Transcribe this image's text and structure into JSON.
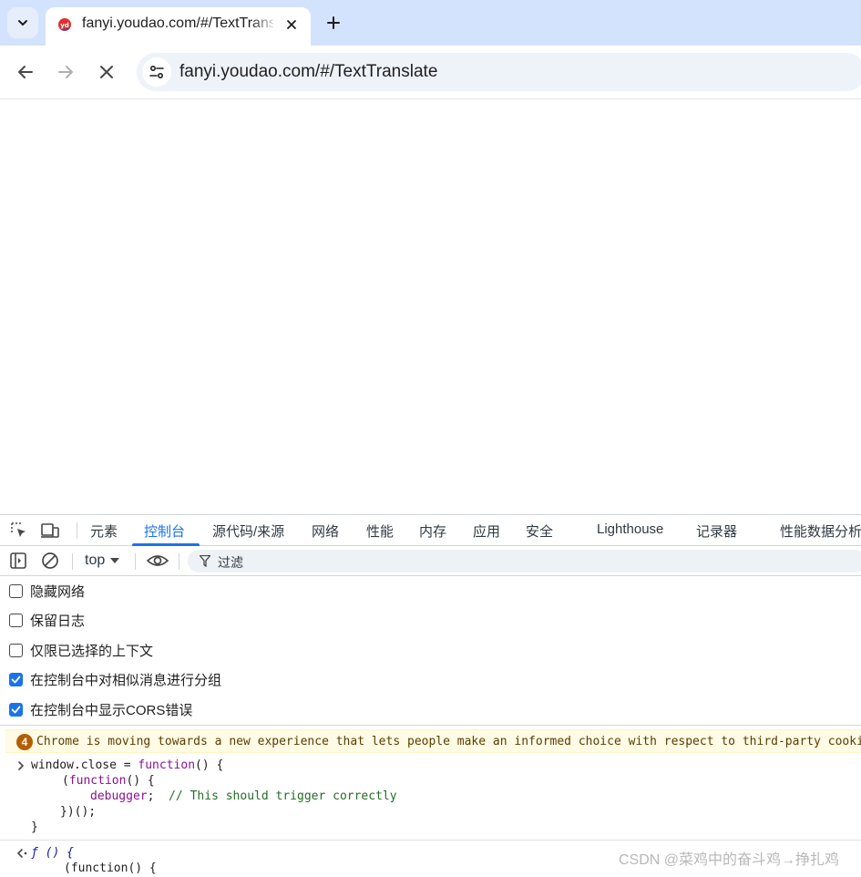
{
  "browser": {
    "tab": {
      "title": "fanyi.youdao.com/#/TextTranslate"
    },
    "address": {
      "url": "fanyi.youdao.com/#/TextTranslate"
    }
  },
  "devtools": {
    "tabs": [
      {
        "label": "元素"
      },
      {
        "label": "控制台"
      },
      {
        "label": "源代码/来源"
      },
      {
        "label": "网络"
      },
      {
        "label": "性能"
      },
      {
        "label": "内存"
      },
      {
        "label": "应用"
      },
      {
        "label": "安全"
      },
      {
        "label": "Lighthouse"
      },
      {
        "label": "记录器"
      },
      {
        "label": "性能数据分析"
      }
    ],
    "active_tab": "控制台",
    "console_toolbar": {
      "context": "top",
      "filter_placeholder": "过滤"
    },
    "settings": [
      {
        "label": "隐藏网络",
        "checked": false
      },
      {
        "label": "保留日志",
        "checked": false
      },
      {
        "label": "仅限已选择的上下文",
        "checked": false
      },
      {
        "label": "在控制台中对相似消息进行分组",
        "checked": true
      },
      {
        "label": "在控制台中显示CORS错误",
        "checked": true
      }
    ],
    "warning": {
      "count": "4",
      "text": "Chrome is moving towards a new experience that lets people make an informed choice with respect to third-party cookies."
    },
    "input_code": {
      "line1_a": "window.close = ",
      "line1_kw": "function",
      "line1_b": "() {",
      "line2_a": "(",
      "line2_kw": "function",
      "line2_b": "() {",
      "line3_kw": "debugger",
      "line3_b": ";  ",
      "line3_comment": "// This should trigger correctly",
      "line4": "})();",
      "line5": "}"
    },
    "output_code": {
      "fn_marker": "ƒ",
      "line1_b": " () {",
      "line2": "(function() {"
    }
  },
  "watermark": "CSDN @菜鸡中的奋斗鸡→挣扎鸡"
}
